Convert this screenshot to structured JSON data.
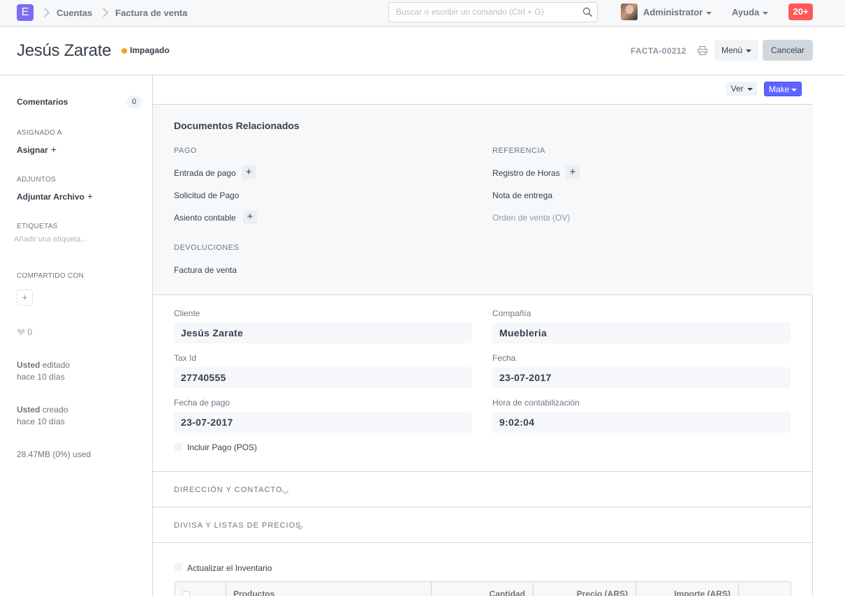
{
  "navbar": {
    "logo": "E",
    "breadcrumbs": [
      "Cuentas",
      "Factura de venta"
    ],
    "search_placeholder": "Buscar o escribir un comando (Ctrl + G)",
    "user": "Administrator",
    "help": "Ayuda",
    "notifications": "20+"
  },
  "header": {
    "title": "Jesús Zarate",
    "status": "Impagado",
    "status_color": "#ff9f1a",
    "doc_id": "FACTA-00212",
    "menu_label": "Menú",
    "cancel_label": "Cancelar"
  },
  "sidebar": {
    "comments_label": "Comentarios",
    "comments_count": "0",
    "assigned_label": "ASIGNADO A",
    "assign_action": "Asignar",
    "attachments_label": "ADJUNTOS",
    "attach_action": "Adjuntar Archivo",
    "tags_label": "ETIQUETAS",
    "tags_placeholder": "Añadir una etiqueta...",
    "shared_label": "COMPARTIDO CON",
    "likes": "0",
    "edited_user": "Usted",
    "edited_action": "editado",
    "edited_time": "hace 10 días",
    "created_user": "Usted",
    "created_action": "creado",
    "created_time": "hace 10 días",
    "storage": "28.47MB (0%) used"
  },
  "toolbar": {
    "view_label": "Ver",
    "make_label": "Make"
  },
  "related": {
    "title": "Documentos Relacionados",
    "payment_head": "PAGO",
    "payment_entry": "Entrada de pago",
    "payment_request": "Solicitud de Pago",
    "journal_entry": "Asiento contable",
    "returns_head": "DEVOLUCIONES",
    "sales_invoice": "Factura de venta",
    "reference_head": "REFERENCIA",
    "timesheet": "Registro de Horas",
    "delivery_note": "Nota de entrega",
    "sales_order": "Orden de venta (OV)"
  },
  "form": {
    "customer_label": "Cliente",
    "customer": "Jesús Zarate",
    "company_label": "Compañía",
    "company": "Muebleria",
    "tax_label": "Tax Id",
    "tax_id": "27740555",
    "date_label": "Fecha",
    "date": "23-07-2017",
    "due_label": "Fecha de pago",
    "due_date": "23-07-2017",
    "time_label": "Hora de contabilización",
    "posting_time": "9:02:04",
    "pos_label": "Incluir Pago (POS)"
  },
  "sections": {
    "address": "DIRECCIÓN Y CONTACTO",
    "currency": "DIVISA Y LISTAS DE PRECIOS"
  },
  "items": {
    "update_stock": "Actualizar el Inventario",
    "columns": [
      "Productos",
      "Cantidad",
      "Precio (ARS)",
      "Importe (ARS)"
    ]
  }
}
